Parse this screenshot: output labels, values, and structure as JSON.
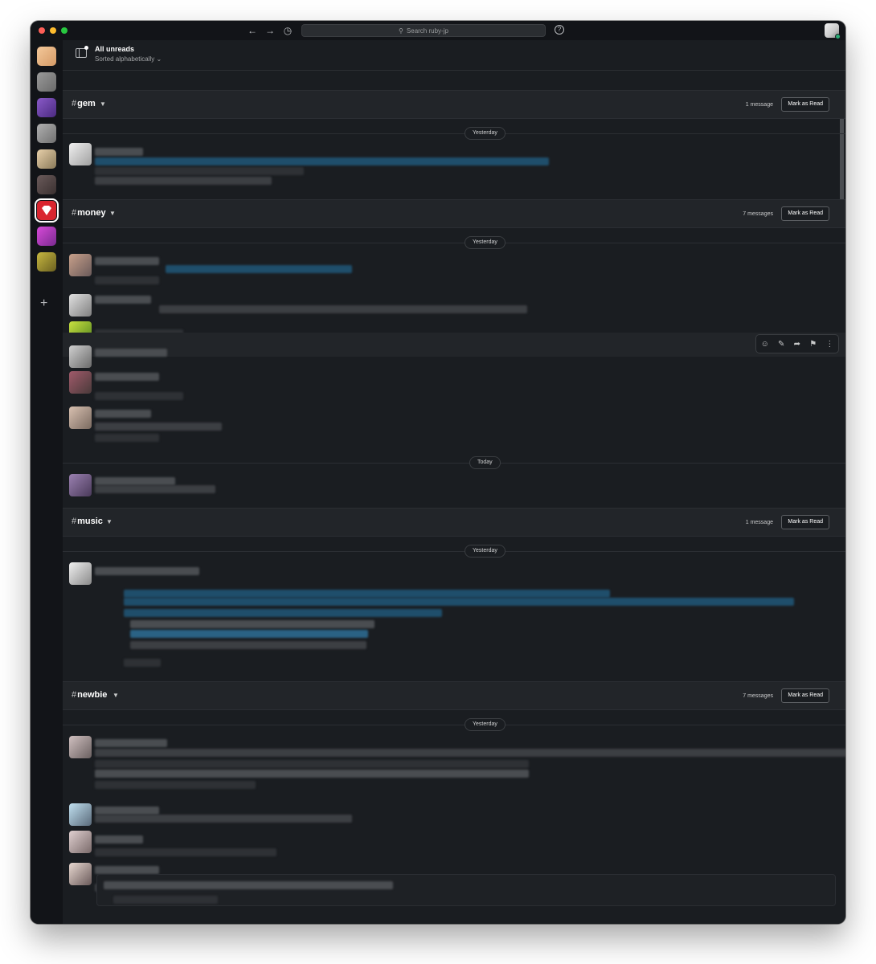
{
  "window": {
    "search_placeholder": "Search ruby-jp",
    "help_label": "?"
  },
  "header": {
    "title": "All unreads",
    "subtitle": "Sorted alphabetically ⌄"
  },
  "workspaces": [
    {
      "name": "workspace-1",
      "color": "#e9b57f"
    },
    {
      "name": "workspace-2",
      "color": "#8a8a8a"
    },
    {
      "name": "workspace-3",
      "color": "#6b3fa0"
    },
    {
      "name": "workspace-4",
      "color": "#9a9a9a"
    },
    {
      "name": "workspace-5",
      "color": "#d8c09a"
    },
    {
      "name": "workspace-6",
      "color": "#5a4a4a"
    },
    {
      "name": "ruby-jp",
      "color": "#d9252f"
    },
    {
      "name": "workspace-8",
      "color": "#b03db5"
    },
    {
      "name": "workspace-9",
      "color": "#a89a2a"
    }
  ],
  "sections": [
    {
      "channel": "gem",
      "count": "1 message",
      "mark_read": "Mark as Read",
      "dates": [
        "Yesterday"
      ]
    },
    {
      "channel": "money",
      "count": "7 messages",
      "mark_read": "Mark as Read",
      "dates": [
        "Yesterday",
        "Today"
      ]
    },
    {
      "channel": "music",
      "count": "1 message",
      "mark_read": "Mark as Read",
      "dates": [
        "Yesterday"
      ]
    },
    {
      "channel": "newbie",
      "count": "7 messages",
      "mark_read": "Mark as Read",
      "dates": [
        "Yesterday"
      ]
    }
  ],
  "hover_toolbar": {
    "icons": [
      "add-reaction-icon",
      "reply-in-thread-icon",
      "share-icon",
      "bookmark-icon",
      "more-actions-icon"
    ]
  }
}
